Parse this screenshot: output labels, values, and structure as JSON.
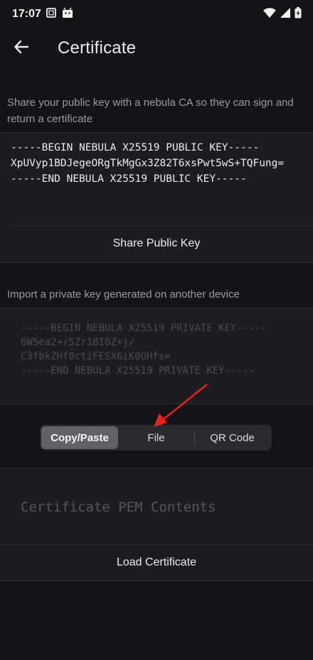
{
  "status_bar": {
    "time": "17:07"
  },
  "app_bar": {
    "title": "Certificate"
  },
  "public_key_section": {
    "description": "Share your public key with a nebula CA so they can sign and return a certificate",
    "key_text": "-----BEGIN NEBULA X25519 PUBLIC KEY-----\nXpUVyp1BDJegeORgTkMgGx3Z82T6xsPwt5wS+TQFung=\n-----END NEBULA X25519 PUBLIC KEY-----",
    "share_button": "Share Public Key"
  },
  "private_key_section": {
    "description": "Import a private key generated on another device",
    "key_text": "-----BEGIN NEBULA X25519 PRIVATE KEY-----\n6W5ea2+/5Zr18I0Z+j/\nC3fbkZHf0ctiFESX6iK0OHfs=\n-----END NEBULA X25519 PRIVATE KEY-----"
  },
  "import_mode": {
    "options": [
      "Copy/Paste",
      "File",
      "QR Code"
    ],
    "selected": "Copy/Paste"
  },
  "certificate": {
    "placeholder": "Certificate PEM Contents",
    "load_button": "Load Certificate"
  },
  "annotation": {
    "arrow_color": "#e8221b"
  }
}
